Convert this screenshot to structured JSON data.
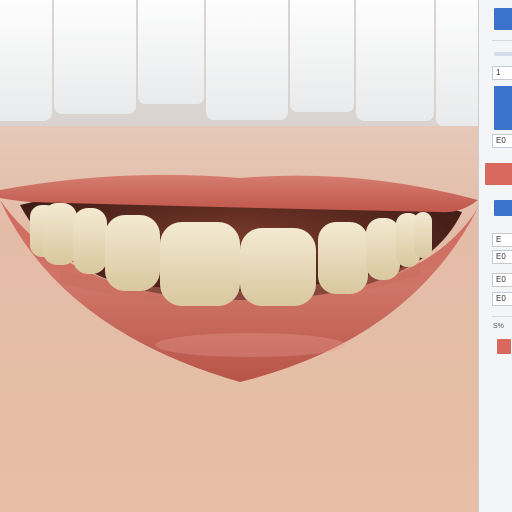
{
  "canvas": {
    "image_subject": "smile-with-teeth"
  },
  "panel": {
    "fields": [
      "1",
      "E0",
      "E",
      "E0",
      "E0",
      "E0"
    ],
    "section_label": "S%",
    "colors": {
      "primary_swatch": "#3a73c9",
      "accent_swatch": "#d9695f",
      "panel_bg": "#f4f5f7"
    }
  }
}
